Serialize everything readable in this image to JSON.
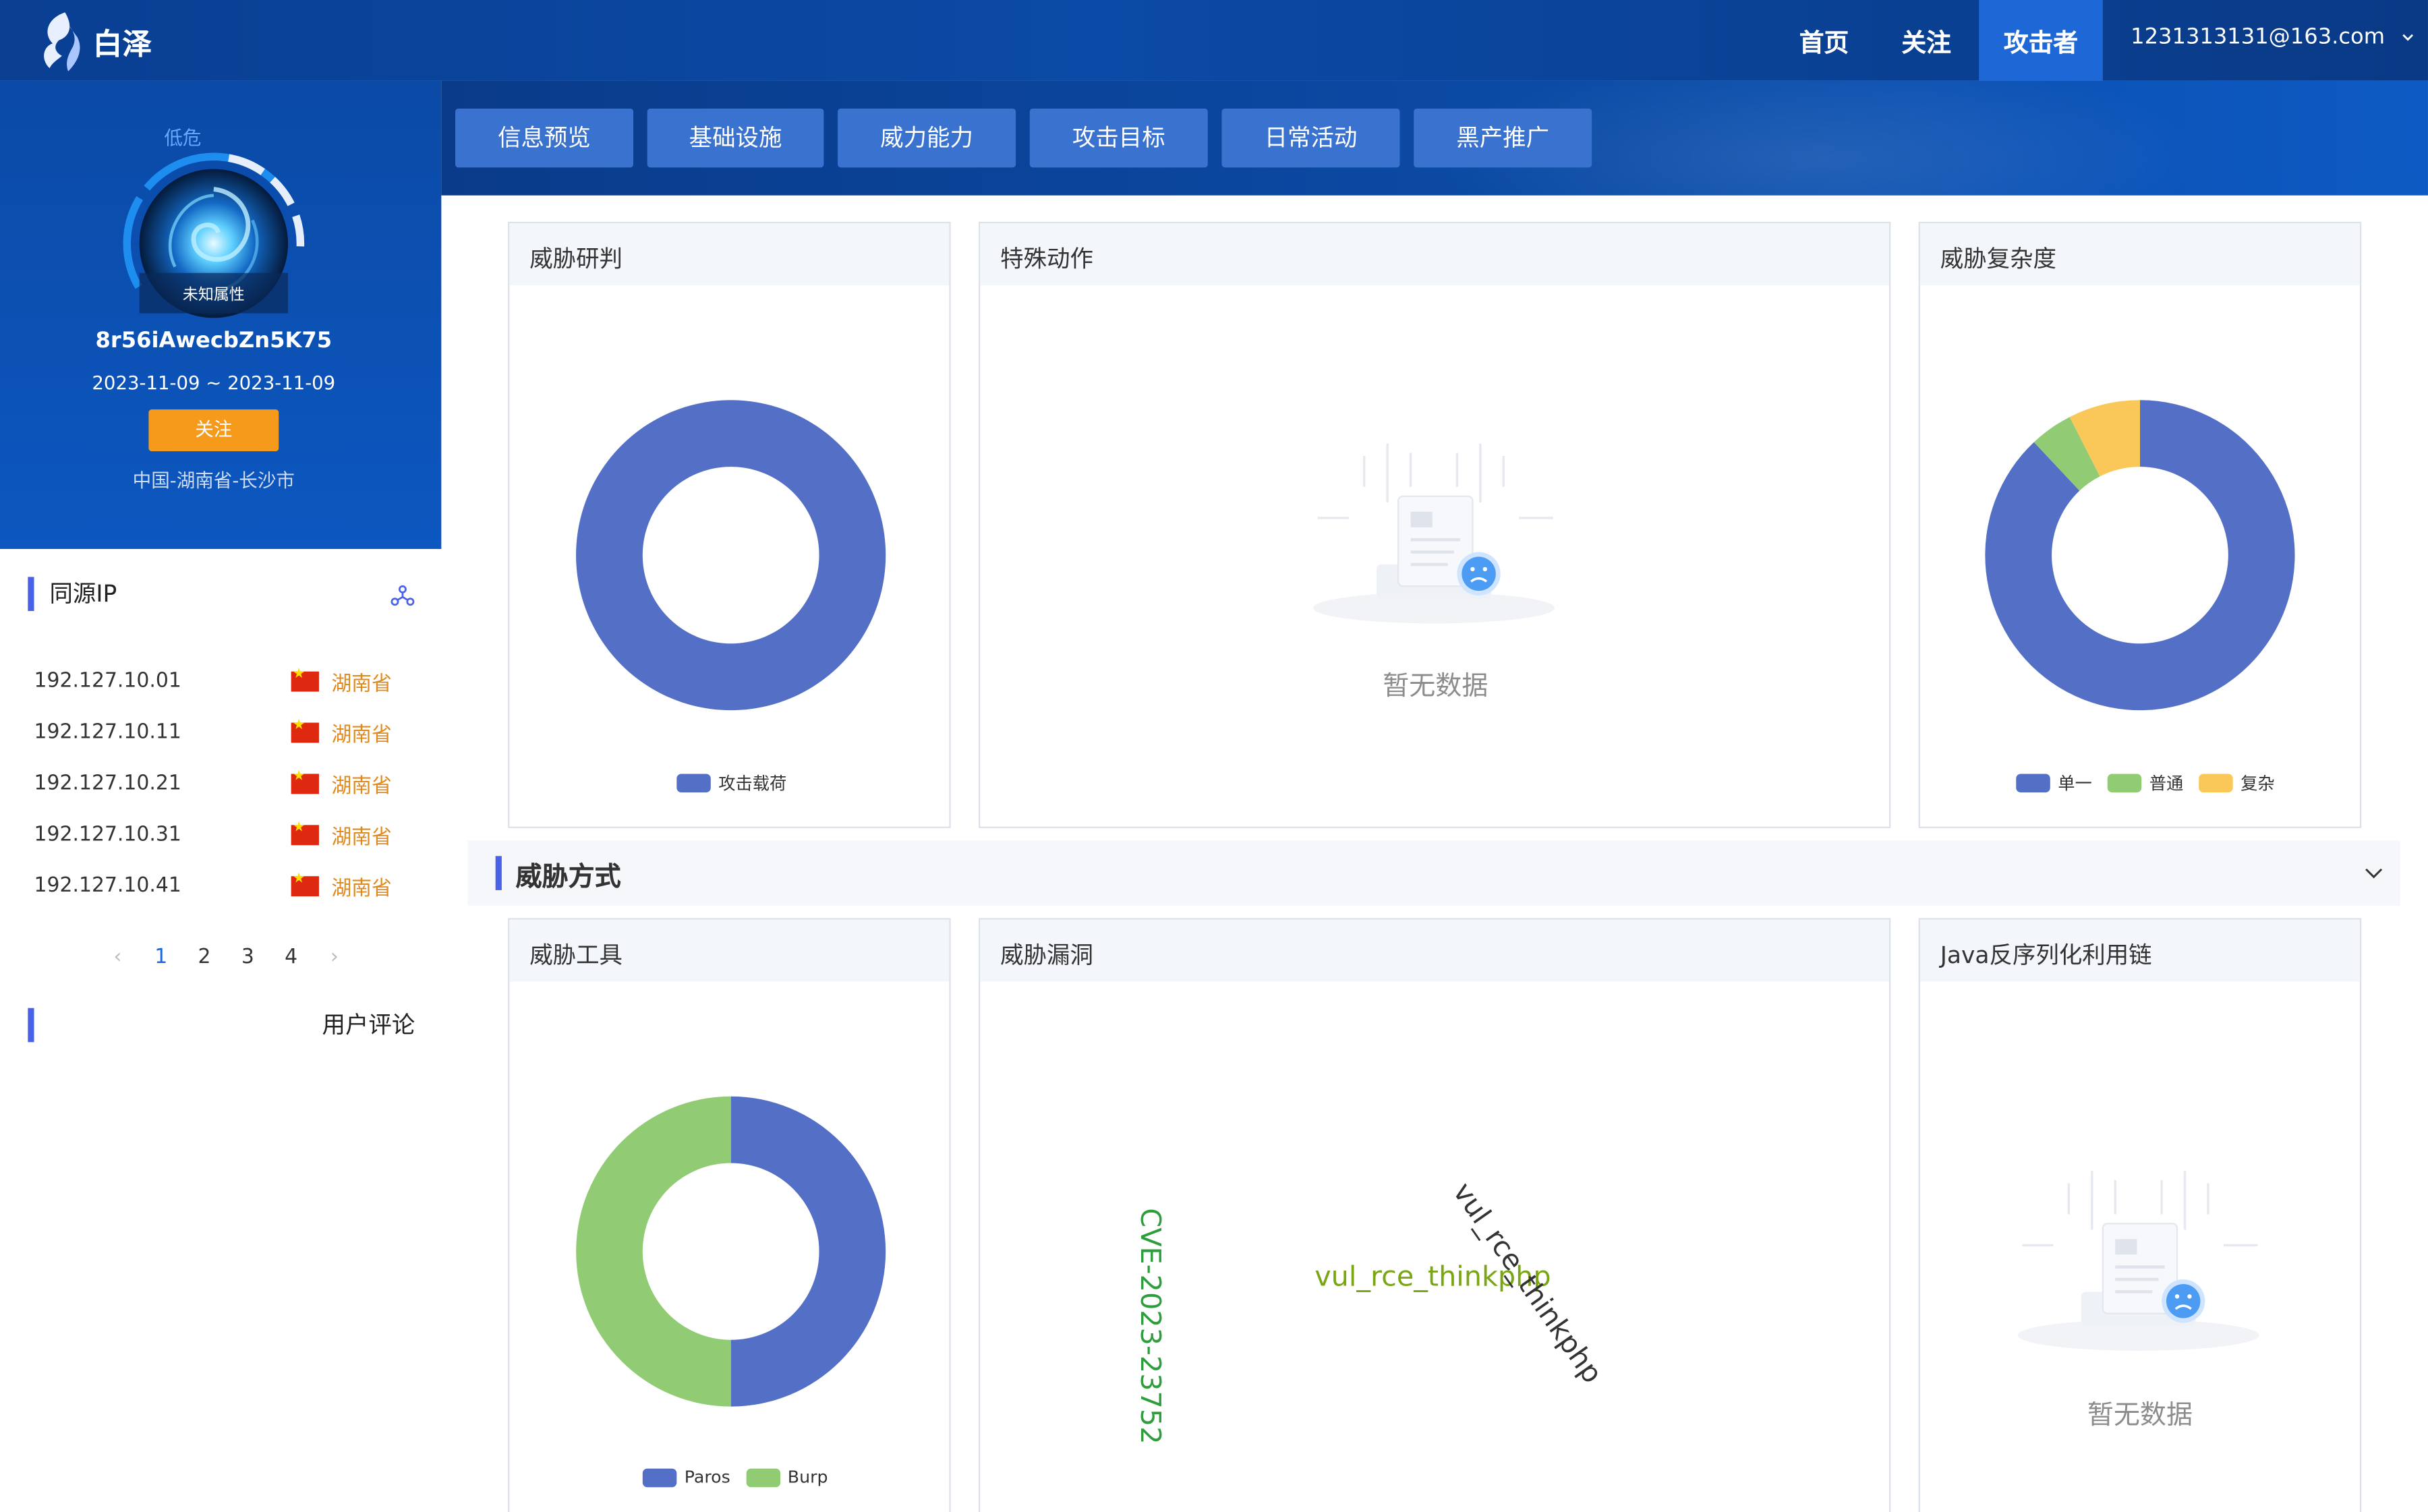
{
  "app": {
    "name": "白泽"
  },
  "nav": {
    "items": [
      "首页",
      "关注",
      "攻击者"
    ],
    "active": "攻击者",
    "user": "1231313131@163.com"
  },
  "tabs": [
    "信息预览",
    "基础设施",
    "威力能力",
    "攻击目标",
    "日常活动",
    "黑产推广"
  ],
  "profile": {
    "risk_label": "低危",
    "attribute": "未知属性",
    "id": "8r56iAwecbZn5K75",
    "dates": "2023-11-09 ~ 2023-11-09",
    "follow_label": "关注",
    "location": "中国-湖南省-长沙市"
  },
  "same_source": {
    "title": "同源IP",
    "rows": [
      {
        "ip": "192.127.10.01",
        "province": "湖南省"
      },
      {
        "ip": "192.127.10.11",
        "province": "湖南省"
      },
      {
        "ip": "192.127.10.21",
        "province": "湖南省"
      },
      {
        "ip": "192.127.10.31",
        "province": "湖南省"
      },
      {
        "ip": "192.127.10.41",
        "province": "湖南省"
      }
    ],
    "pages": [
      "1",
      "2",
      "3",
      "4"
    ],
    "current_page": "1"
  },
  "comments": {
    "title": "用户评论"
  },
  "cards": {
    "research": "威胁研判",
    "special": "特殊动作",
    "complexity": "威胁复杂度",
    "tools": "威胁工具",
    "vulns": "威胁漏洞",
    "java": "Java反序列化利用链"
  },
  "section": {
    "title": "威胁方式"
  },
  "empty_text": "暂无数据",
  "colors": {
    "blue": "#5470c6",
    "green": "#91cc75",
    "yellow": "#fac858",
    "nav_active": "#1d67d6",
    "follow": "#f59a1b"
  },
  "chart_data": [
    {
      "type": "pie",
      "title": "威胁研判",
      "series": [
        {
          "name": "攻击载荷",
          "value": 100
        }
      ]
    },
    {
      "type": "pie",
      "title": "威胁复杂度",
      "series": [
        {
          "name": "单一",
          "value": 88
        },
        {
          "name": "普通",
          "value": 4.5
        },
        {
          "name": "复杂",
          "value": 7.5
        }
      ]
    },
    {
      "type": "pie",
      "title": "威胁工具",
      "series": [
        {
          "name": "Paros",
          "value": 50
        },
        {
          "name": "Burp",
          "value": 50
        }
      ]
    }
  ],
  "word_cloud": [
    {
      "text": "CVE-2023-23752",
      "color": "#2e9e3c",
      "rotation": 90
    },
    {
      "text": "vul_rce_thinkphp",
      "color": "#7aa614",
      "rotation": 0
    },
    {
      "text": "vul_rce_thinkphp",
      "color": "#333333",
      "rotation": 55
    }
  ]
}
